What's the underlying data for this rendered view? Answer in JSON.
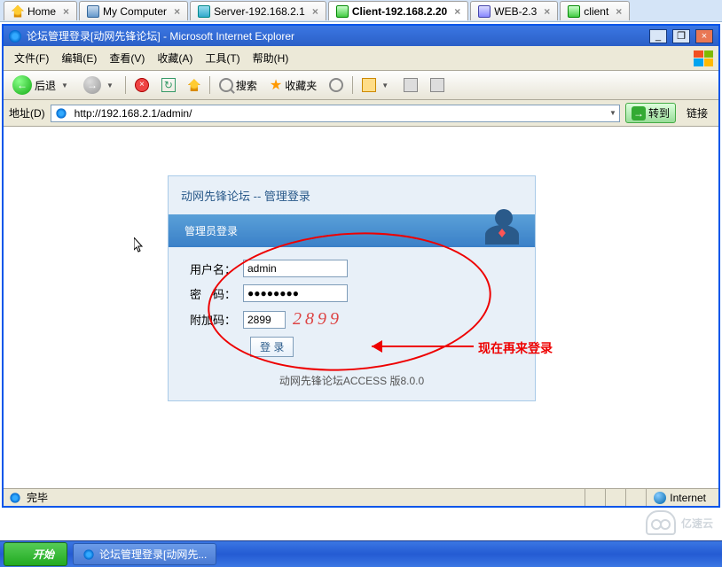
{
  "workspace_tabs": {
    "home": "Home",
    "mycomputer": "My Computer",
    "server": "Server-192.168.2.1",
    "client": "Client-192.168.2.20",
    "web": "WEB-2.3",
    "client2": "client"
  },
  "ie": {
    "title": "论坛管理登录[动网先锋论坛] - Microsoft Internet Explorer",
    "menu": {
      "file": "文件(F)",
      "edit": "编辑(E)",
      "view": "查看(V)",
      "favorites": "收藏(A)",
      "tools": "工具(T)",
      "help": "帮助(H)"
    },
    "toolbar": {
      "back": "后退",
      "search": "搜索",
      "favorites": "收藏夹"
    },
    "address_label": "地址(D)",
    "url": "http://192.168.2.1/admin/",
    "go": "转到",
    "links": "链接",
    "status_done": "完毕",
    "status_zone": "Internet"
  },
  "login": {
    "breadcrumb": "动网先锋论坛 -- 管理登录",
    "header": "管理员登录",
    "username_label": "用户名：",
    "username_value": "admin",
    "password_label": "密　码：",
    "password_value": "●●●●●●●●",
    "captcha_label": "附加码：",
    "captcha_input": "2899",
    "captcha_image": "2899",
    "submit": "登 录",
    "footer": "动网先锋论坛ACCESS 版8.0.0"
  },
  "annotation": "现在再来登录",
  "taskbar": {
    "start": "开始",
    "task1": "论坛管理登录[动网先..."
  },
  "watermark": "亿速云"
}
